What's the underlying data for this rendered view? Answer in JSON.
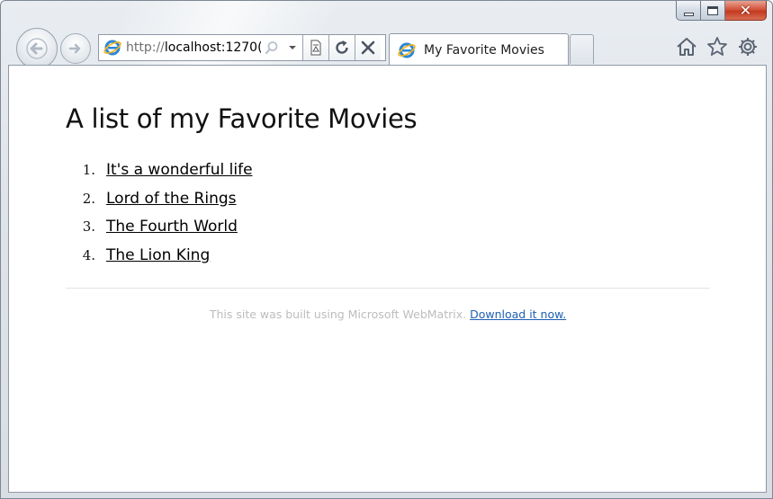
{
  "browser": {
    "address_prefix": "http://",
    "address_host": "localhost:1270(",
    "tab_title": "My Favorite Movies"
  },
  "page": {
    "heading": "A list of my Favorite Movies",
    "movies": [
      {
        "num": "1.",
        "title": "It's a wonderful life"
      },
      {
        "num": "2.",
        "title": "Lord of the Rings"
      },
      {
        "num": "3.",
        "title": "The Fourth World"
      },
      {
        "num": "4.",
        "title": "The Lion King"
      }
    ],
    "footer": {
      "text": "This site was built using Microsoft WebMatrix.",
      "link": "Download it now."
    }
  },
  "colors": {
    "link_blue": "#1d5fb3",
    "close_red": "#c43a20",
    "footer_gray": "#bdbdbd"
  },
  "icons": [
    "back-arrow-icon",
    "forward-arrow-icon",
    "ie-logo-icon",
    "search-icon",
    "dropdown-icon",
    "compat-view-icon",
    "refresh-icon",
    "stop-icon",
    "home-icon",
    "favorites-star-icon",
    "gear-icon",
    "minimize-icon",
    "maximize-icon",
    "close-icon"
  ]
}
